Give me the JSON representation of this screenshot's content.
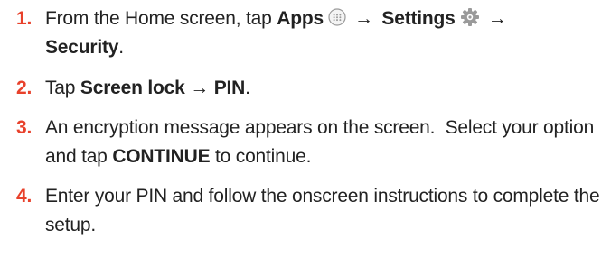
{
  "steps": [
    {
      "number": "1.",
      "text_from": "From the Home screen, tap",
      "apps_label": "Apps",
      "apps_icon": "apps-grid-icon",
      "arrow1": "→",
      "settings_label": "Settings",
      "settings_icon": "gear-icon",
      "arrow2": "→",
      "security_label": "Security",
      "period": "."
    },
    {
      "number": "2.",
      "text_tap": "Tap",
      "screen_lock_label": "Screen lock",
      "arrow": "→",
      "pin_label": "PIN",
      "period": "."
    },
    {
      "number": "3.",
      "text_before": "An encryption message appears on the screen.  Select your option and tap",
      "continue_label": "CONTINUE",
      "text_after": "to continue."
    },
    {
      "number": "4.",
      "text": "Enter your PIN and follow the onscreen instructions to complete the setup."
    }
  ],
  "colors": {
    "number": "#e8412b",
    "text": "#222222",
    "icon_gray": "#9a9a9a"
  }
}
